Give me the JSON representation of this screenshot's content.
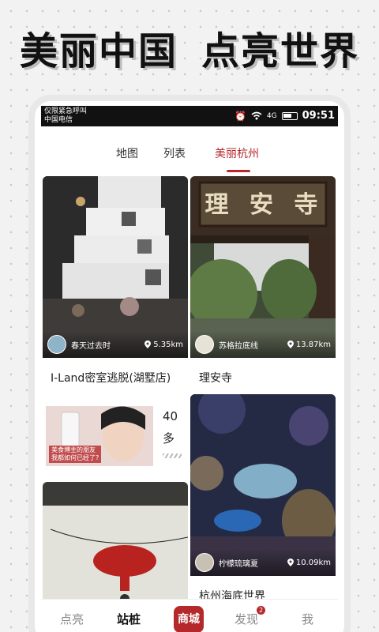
{
  "headline": {
    "part1": "美丽中国",
    "part2": "点亮世界"
  },
  "statusbar": {
    "carrier_line1": "仅限紧急呼叫",
    "carrier_line2": "中国电信",
    "signal_text": "4G",
    "time": "09:51"
  },
  "tabs": [
    {
      "label": "地图",
      "active": false
    },
    {
      "label": "列表",
      "active": false
    },
    {
      "label": "美丽杭州",
      "active": true
    }
  ],
  "cards": [
    {
      "user": "春天过去时",
      "distance": "5.35km",
      "title": "I-Land密室逃脱(湖墅店)"
    },
    {
      "user": "苏格拉底线",
      "distance": "13.87km",
      "title": "理安寺",
      "sign_text": "理 安 寺"
    },
    {
      "user": "柠檬琉璃夏",
      "distance": "10.09km",
      "title": "杭州海底世界"
    }
  ],
  "ad_card": {
    "count": "40",
    "unit": "多",
    "caption_line1": "美食博主的朋友",
    "caption_line2": "我都如何已经了?"
  },
  "bottom_nav": [
    {
      "label": "点亮",
      "active": false
    },
    {
      "label": "站桩",
      "active": true
    },
    {
      "label": "商城",
      "active": false,
      "center": true
    },
    {
      "label": "发现",
      "active": false,
      "badge": "2"
    },
    {
      "label": "我",
      "active": false
    }
  ],
  "colors": {
    "accent": "#b5292b",
    "background": "#f2f2f2"
  }
}
